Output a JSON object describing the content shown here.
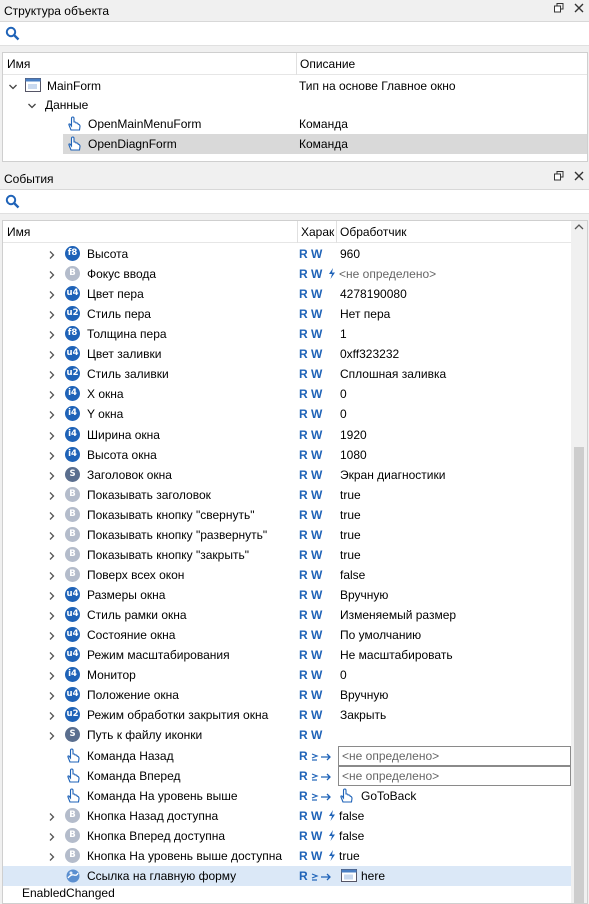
{
  "panel1": {
    "title": "Структура объекта",
    "columns": {
      "name": "Имя",
      "desc": "Описание"
    },
    "rows": [
      {
        "name": "MainForm",
        "desc": "Тип на основе Главное окно"
      },
      {
        "name": "Данные",
        "desc": ""
      },
      {
        "name": "OpenMainMenuForm",
        "desc": "Команда"
      },
      {
        "name": "OpenDiagnForm",
        "desc": "Команда"
      }
    ]
  },
  "panel2": {
    "title": "События",
    "columns": {
      "name": "Имя",
      "chars": "Харак",
      "handler": "Обработчик"
    },
    "rows": [
      {
        "badge": "f8",
        "name": "Высота",
        "rw": "R W",
        "val": "960"
      },
      {
        "badge": "B",
        "name": "Фокус ввода",
        "rw": "R W",
        "val": "<не определено>"
      },
      {
        "badge": "u4",
        "name": "Цвет пера",
        "rw": "R W",
        "val": "4278190080"
      },
      {
        "badge": "u2",
        "name": "Стиль пера",
        "rw": "R W",
        "val": "Нет пера"
      },
      {
        "badge": "f8",
        "name": "Толщина пера",
        "rw": "R W",
        "val": "1"
      },
      {
        "badge": "u4",
        "name": "Цвет заливки",
        "rw": "R W",
        "val": "0xff323232"
      },
      {
        "badge": "u2",
        "name": "Стиль заливки",
        "rw": "R W",
        "val": "Сплошная заливка"
      },
      {
        "badge": "i4",
        "name": "X окна",
        "rw": "R W",
        "val": "0"
      },
      {
        "badge": "i4",
        "name": "Y окна",
        "rw": "R W",
        "val": "0"
      },
      {
        "badge": "i4",
        "name": "Ширина окна",
        "rw": "R W",
        "val": "1920"
      },
      {
        "badge": "i4",
        "name": "Высота окна",
        "rw": "R W",
        "val": "1080"
      },
      {
        "badge": "S",
        "name": "Заголовок окна",
        "rw": "R W",
        "val": "Экран диагностики"
      },
      {
        "badge": "B",
        "name": "Показывать заголовок",
        "rw": "R W",
        "val": "true"
      },
      {
        "badge": "B",
        "name": "Показывать кнопку \"свернуть\"",
        "rw": "R W",
        "val": "true"
      },
      {
        "badge": "B",
        "name": "Показывать кнопку \"развернуть\"",
        "rw": "R W",
        "val": "true"
      },
      {
        "badge": "B",
        "name": "Показывать кнопку \"закрыть\"",
        "rw": "R W",
        "val": "true"
      },
      {
        "badge": "B",
        "name": "Поверх всех окон",
        "rw": "R W",
        "val": "false"
      },
      {
        "badge": "u4",
        "name": "Размеры окна",
        "rw": "R W",
        "val": "Вручную"
      },
      {
        "badge": "u4",
        "name": "Стиль рамки окна",
        "rw": "R W",
        "val": "Изменяемый размер"
      },
      {
        "badge": "u4",
        "name": "Состояние окна",
        "rw": "R W",
        "val": "По умолчанию"
      },
      {
        "badge": "u4",
        "name": "Режим масштабирования",
        "rw": "R W",
        "val": "Не масштабировать"
      },
      {
        "badge": "i4",
        "name": "Монитор",
        "rw": "R W",
        "val": "0"
      },
      {
        "badge": "u4",
        "name": "Положение окна",
        "rw": "R W",
        "val": "Вручную"
      },
      {
        "badge": "u2",
        "name": "Режим обработки закрытия окна",
        "rw": "R W",
        "val": "Закрыть"
      },
      {
        "badge": "S",
        "name": "Путь к файлу иконки",
        "rw": "R W",
        "val": ""
      },
      {
        "badge": "hand",
        "name": "Команда Назад",
        "rw": "R",
        "val": "<не определено>"
      },
      {
        "badge": "hand",
        "name": "Команда Вперед",
        "rw": "R",
        "val": "<не определено>"
      },
      {
        "badge": "hand",
        "name": "Команда На уровень выше",
        "rw": "R",
        "val": "GoToBack"
      },
      {
        "badge": "B",
        "name": "Кнопка Назад доступна",
        "rw": "R W",
        "val": "false"
      },
      {
        "badge": "B",
        "name": "Кнопка Вперед доступна",
        "rw": "R W",
        "val": "false"
      },
      {
        "badge": "B",
        "name": "Кнопка На уровень выше доступна",
        "rw": "R W",
        "val": "true"
      },
      {
        "badge": "link",
        "name": "Ссылка на главную форму",
        "rw": "R",
        "val": "here"
      }
    ],
    "footer": "EnabledChanged"
  }
}
